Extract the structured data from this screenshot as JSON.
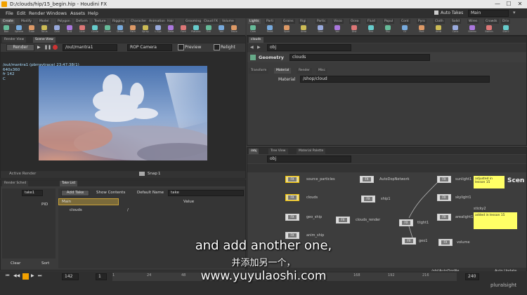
{
  "window": {
    "title": "D:/clouds/hip/15_begin.hip - Houdini FX",
    "min": "—",
    "max": "☐",
    "close": "✕"
  },
  "menu": [
    "File",
    "Edit",
    "Render",
    "Windows",
    "Assets",
    "Help"
  ],
  "top_right": {
    "auto_takes": "Auto Takes",
    "desktop": "Main"
  },
  "shelf_left": {
    "tabs": [
      "Create",
      "Modify",
      "Model",
      "Polygon",
      "Deform",
      "Texture",
      "Rigging",
      "Character",
      "Animation",
      "Hair",
      "Grooming",
      "Cloud FX",
      "Volume"
    ],
    "tools": [
      "Box",
      "Sphere",
      "Tube",
      "Torus",
      "Grid",
      "Null",
      "Line",
      "Circle",
      "Curve",
      "Draw",
      "Path",
      "Spray",
      "L-Sys",
      "Meta",
      "Font",
      "Platonic",
      "Ext",
      "Vol",
      "Trace"
    ]
  },
  "shelf_right": {
    "tabs": [
      "Lights",
      "Parti",
      "Grains",
      "Rigi",
      "Partic",
      "Visco",
      "Ocea",
      "Fluid",
      "Popul",
      "Cont",
      "Pyro",
      "Cloth",
      "Solid",
      "Wires",
      "Crowds",
      "Driv"
    ],
    "tools": [
      "Cam",
      "Point",
      "Spot",
      "Area",
      "Geo",
      "Vol",
      "Dist",
      "Env",
      "Sky",
      "GI",
      "Port",
      "Amb",
      "Caus",
      "Stereo",
      "Switch",
      "Ster2"
    ]
  },
  "render_view": {
    "tabs": [
      "Render View",
      "Scene View"
    ],
    "render_btn": "Render",
    "path": "/out/mantra1",
    "camera": "ROP Camera",
    "preview": "Preview",
    "relight": "Relight",
    "overlay": [
      "/out/mantra1 (pbrraytrace) 23:47:38(1)",
      "640x360",
      "fr 142",
      "C"
    ],
    "active_render": "Active Render",
    "snap": "Snap",
    "snap_val": "1"
  },
  "params": {
    "tab": "clouds",
    "path": "obj",
    "type": "Geometry",
    "name": "clouds",
    "subtabs": [
      "Transform",
      "Material",
      "Render",
      "Misc"
    ],
    "material_label": "Material",
    "material_value": "/shop/cloud"
  },
  "network": {
    "tabs": [
      "/obj",
      "Tree View",
      "Material Palette"
    ],
    "path": "obj",
    "nodes": [
      {
        "label": "source_particles"
      },
      {
        "label": "AutoDopNetwork"
      },
      {
        "label": "sunlight1"
      },
      {
        "label": "clouds"
      },
      {
        "label": "ship1"
      },
      {
        "label": "skylight1"
      },
      {
        "label": "geo_ship"
      },
      {
        "label": "clouds_render"
      },
      {
        "label": "arealight1"
      },
      {
        "label": "tlight1"
      },
      {
        "label": "anim_ship"
      },
      {
        "label": "geo1"
      },
      {
        "label": "volume"
      }
    ],
    "sticky1": {
      "title": "",
      "text": "adjusted in lesson 15"
    },
    "sticky2": {
      "title": "sticky2",
      "text": "added in lesson 15"
    },
    "scene_label": "Scen",
    "status_path": "/obj/AutoDopNe",
    "auto_update": "Auto Update"
  },
  "takes": {
    "tabs": [
      "Render Sched",
      "Take List"
    ],
    "take_label": "take1",
    "add_take": "Add Take",
    "show_contents": "Show Contents",
    "default_name_label": "Default Name",
    "default_name": "take",
    "pid": "PID",
    "clear": "Clear",
    "sort": "Sort",
    "columns": [
      "Main",
      "",
      "Value"
    ],
    "rows": [
      "clouds",
      "/"
    ]
  },
  "timeline": {
    "frame": "142",
    "start": "1",
    "end": "240",
    "ticks": [
      "1",
      "24",
      "48",
      "72",
      "96",
      "120",
      "144",
      "168",
      "192",
      "216"
    ]
  },
  "subtitles": {
    "en": "and add another one,",
    "zh": "并添加另一个，",
    "url": "www.yuyulaoshi.com"
  },
  "watermark": "pluralsight"
}
